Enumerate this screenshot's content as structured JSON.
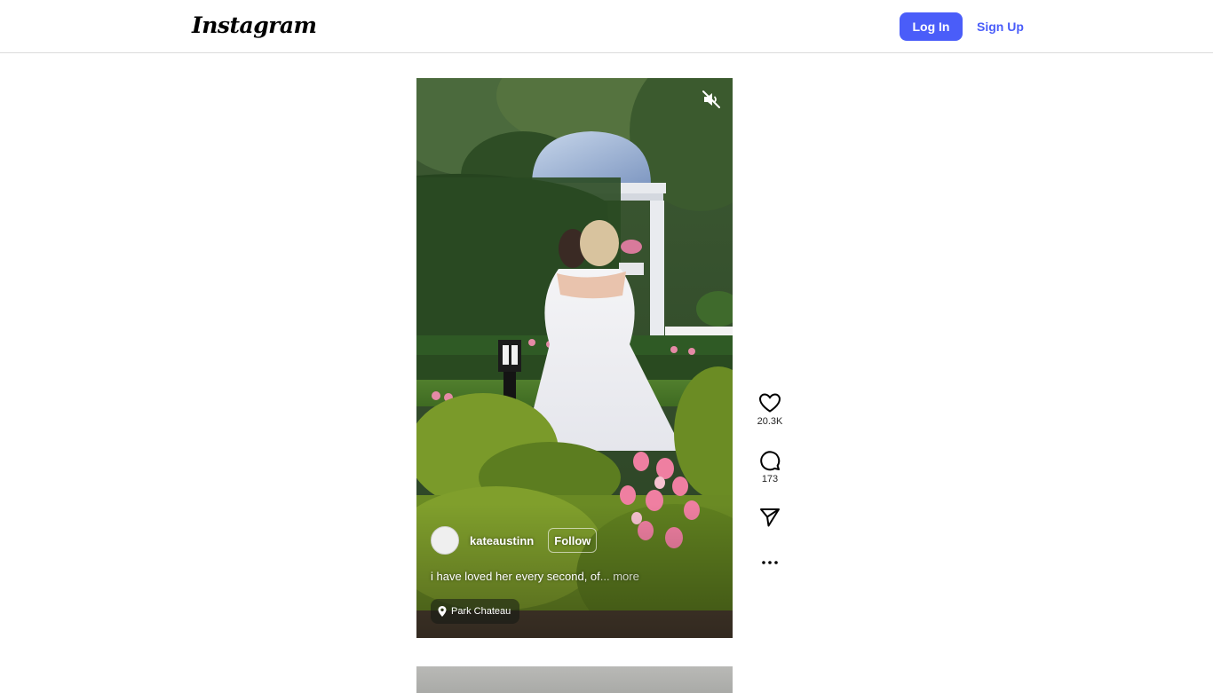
{
  "header": {
    "logo": "Instagram",
    "login_label": "Log In",
    "signup_label": "Sign Up"
  },
  "reel": {
    "author": "kateaustinn",
    "follow_label": "Follow",
    "caption": "i have loved her every second, of",
    "caption_more": "... more",
    "location": "Park Chateau",
    "mute_icon": "speaker-muted-icon"
  },
  "actions": {
    "likes": "20.3K",
    "comments": "173",
    "share_icon": "paper-plane-icon",
    "more_icon": "more-horizontal-icon"
  },
  "colors": {
    "brand_blue": "#4a5df9"
  }
}
